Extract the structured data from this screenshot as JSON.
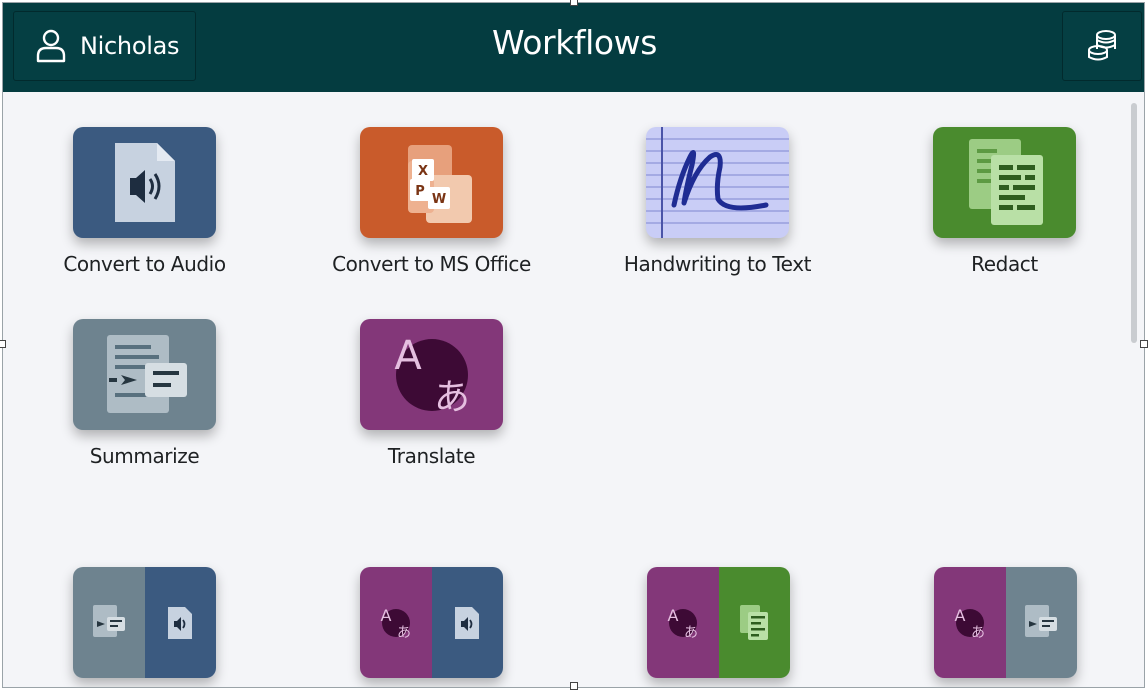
{
  "header": {
    "title": "Workflows",
    "user_name": "Nicholas",
    "user_icon": "person-icon",
    "credits_icon": "coins-stack-icon"
  },
  "workflows": [
    {
      "label": "Convert to Audio",
      "icon": "audio-file-icon",
      "color": "#3b5a80"
    },
    {
      "label": "Convert to MS Office",
      "icon": "ms-office-icon",
      "color": "#c95b2b"
    },
    {
      "label": "Handwriting to Text",
      "icon": "handwriting-icon",
      "color": "#c9cdf6"
    },
    {
      "label": "Redact",
      "icon": "redact-documents-icon",
      "color": "#4a8b2e"
    },
    {
      "label": "Summarize",
      "icon": "summarize-icon",
      "color": "#6e838f"
    },
    {
      "label": "Translate",
      "icon": "translate-icon",
      "color": "#833779"
    }
  ],
  "combined_workflows": [
    {
      "left": "summarize-icon",
      "right": "audio-file-icon"
    },
    {
      "left": "translate-icon",
      "right": "audio-file-icon"
    },
    {
      "left": "translate-icon",
      "right": "redact-documents-icon"
    },
    {
      "left": "translate-icon",
      "right": "summarize-icon"
    }
  ],
  "colors": {
    "header_bg": "#043c40",
    "page_bg": "#f4f5f8",
    "audio": "#3b5a80",
    "office": "#c95b2b",
    "handwriting": "#c9cdf6",
    "redact": "#4a8b2e",
    "summarize": "#6e838f",
    "translate": "#833779"
  }
}
